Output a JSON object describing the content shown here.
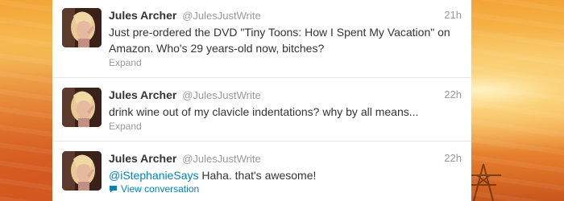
{
  "colors": {
    "name": "#333333",
    "meta": "#999999",
    "link": "#0084b4",
    "divider": "#e8e8e8"
  },
  "tweets": [
    {
      "fullname": "Jules Archer",
      "username": "@JulesJustWrite",
      "time": "21h",
      "text": "Just pre-ordered the DVD \"Tiny Toons: How I Spent My Vacation\" on Amazon. Who's 29 years-old now, bitches?",
      "action": "Expand",
      "avatar_icon": "profile-photo"
    },
    {
      "fullname": "Jules Archer",
      "username": "@JulesJustWrite",
      "time": "22h",
      "text": "drink wine out of my clavicle indentations? why by all means...",
      "action": "Expand",
      "avatar_icon": "profile-photo"
    },
    {
      "fullname": "Jules Archer",
      "username": "@JulesJustWrite",
      "time": "22h",
      "mention": "@iStephanieSays",
      "text": " Haha. that's awesome!",
      "action": "View conversation",
      "action_icon": "speech-bubble-icon",
      "avatar_icon": "profile-photo"
    }
  ]
}
